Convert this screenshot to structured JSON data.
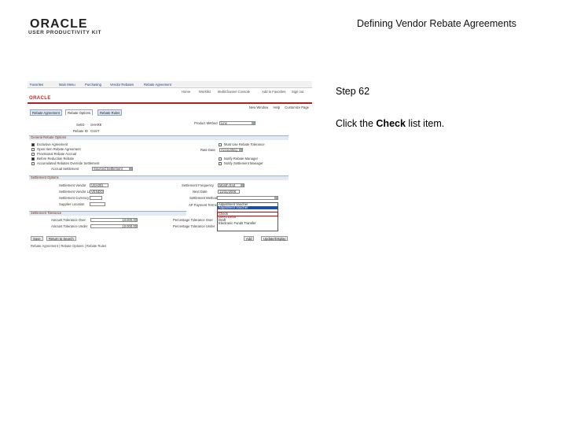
{
  "header": {
    "logo_text": "ORACLE",
    "logo_sub": "USER PRODUCTIVITY KIT",
    "document_title": "Defining Vendor Rebate Agreements"
  },
  "step": {
    "label": "Step 62"
  },
  "instruction": {
    "prefix": "Click the ",
    "target": "Check",
    "suffix": " list item."
  },
  "screenshot": {
    "nav_links": [
      "Favorites",
      "Main Menu",
      "Purchasing",
      "Vendor Rebates",
      "Rebate Agreement"
    ],
    "home_links": [
      "Home",
      "Worklist",
      "MultiChannel Console",
      "Add to Favorites",
      "Sign out"
    ],
    "brand": "ORACLE",
    "top_links": [
      "New Window",
      "Help",
      "Customize Page"
    ],
    "tabs": [
      "Rebate Agreement",
      "Rebate Options",
      "Rebate Rules"
    ],
    "setid_label": "SetID",
    "setid_value": "SHARE",
    "rebate_id_label": "Rebate ID",
    "rebate_id_value": "CUST",
    "product_method_label": "Product Method",
    "product_method_value": "Line",
    "section_rebate": "General Rebate Options",
    "check_items": [
      "Exclusive Agreement",
      "Open Item Rebate Agreement",
      "Provisional Rebate Accrual",
      "Before Reduction Rebate",
      "Accumulated Rebates Override Settlement"
    ],
    "check_states": [
      true,
      false,
      false,
      true,
      false
    ],
    "right_checks": [
      "Must Use Rebate Tolerance",
      "Notify Rebate Manager",
      "Notify Settlement Manager"
    ],
    "rate_label": "Rate Date",
    "rate_value": "Accounting",
    "accrual_label": "Accrual Settlement",
    "accrual_value": "Sourced Settlement",
    "section_settlement": "Settlement Options",
    "settlement_vendor_label": "Settlement Vendor",
    "settlement_vendor_value": "USA001",
    "settlement_site_label": "Settlement Vendor Loc",
    "settlement_site_value": "VENDOR",
    "settlement_currency_label": "Settlement Currency",
    "supplier_label": "Supplier Location",
    "settlement_frequency_label": "Settlement Frequency",
    "settlement_frequency_value": "Month End",
    "next_date_label": "Next Date",
    "next_date_value": "12/31/2008",
    "settlement_method_label": "Settlement Method",
    "ap_payment_label": "AP Payment Terms",
    "dropdown_items": [
      "Adjustment Voucher",
      "Adjustment Voucher",
      "Check",
      "Direct Debit",
      "Draft",
      "Electronic Funds Transfer"
    ],
    "section_tolerance": "Settlement Tolerance",
    "amount_over_label": "Amount Tolerance Over",
    "amount_over_value": "10,000.00",
    "amount_under_label": "Amount Tolerance Under",
    "amount_under_value": "10,000.00",
    "pct_over_label": "Percentage Tolerance Over",
    "pct_under_label": "Percentage Tolerance Under",
    "buttons": [
      "Save",
      "Return to Search",
      "Add",
      "Update/Display"
    ],
    "footer": "Rebate Agreement | Rebate Options | Rebate Rules"
  },
  "colors": {
    "brand_red": "#cc2222",
    "highlight": "#2050a0",
    "callout": "#d00000"
  }
}
